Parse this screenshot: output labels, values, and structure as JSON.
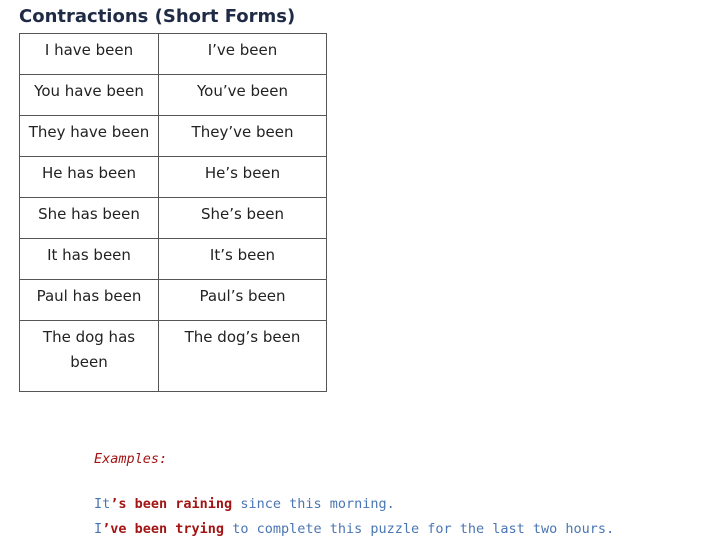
{
  "heading": "Contractions (Short Forms)",
  "rows": [
    {
      "full": "I have been",
      "short": "I’ve been"
    },
    {
      "full": "You have been",
      "short": "You’ve been"
    },
    {
      "full": "They have been",
      "short": "They’ve been"
    },
    {
      "full": "He has been",
      "short": "He’s been"
    },
    {
      "full": "She has been",
      "short": "She’s been"
    },
    {
      "full": "It has been",
      "short": "It’s been"
    },
    {
      "full": "Paul has been",
      "short": "Paul’s been"
    },
    {
      "full": "The dog has been",
      "short": "The dog’s been"
    }
  ],
  "examples": {
    "label": "Examples:",
    "lines": [
      {
        "start": "It",
        "highlight": "’s been raining",
        "rest": " since this morning."
      },
      {
        "start": "I",
        "highlight": "’ve been trying",
        "rest": " to complete this puzzle for the last two hours."
      }
    ]
  },
  "colors": {
    "heading": "#1f2a44",
    "example_plain": "#4a76b3",
    "example_highlight": "#a31515"
  }
}
